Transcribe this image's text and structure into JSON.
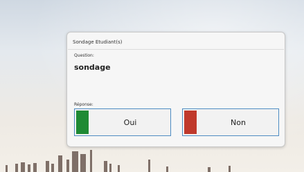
{
  "dialog": {
    "title": "Sondage Etudiant(s)",
    "question_label": "Question:",
    "question_text": "sondage",
    "response_label": "Réponse:",
    "answers": [
      {
        "label": "Oui",
        "color": "#1f8a34"
      },
      {
        "label": "Non",
        "color": "#c0392b"
      }
    ]
  }
}
